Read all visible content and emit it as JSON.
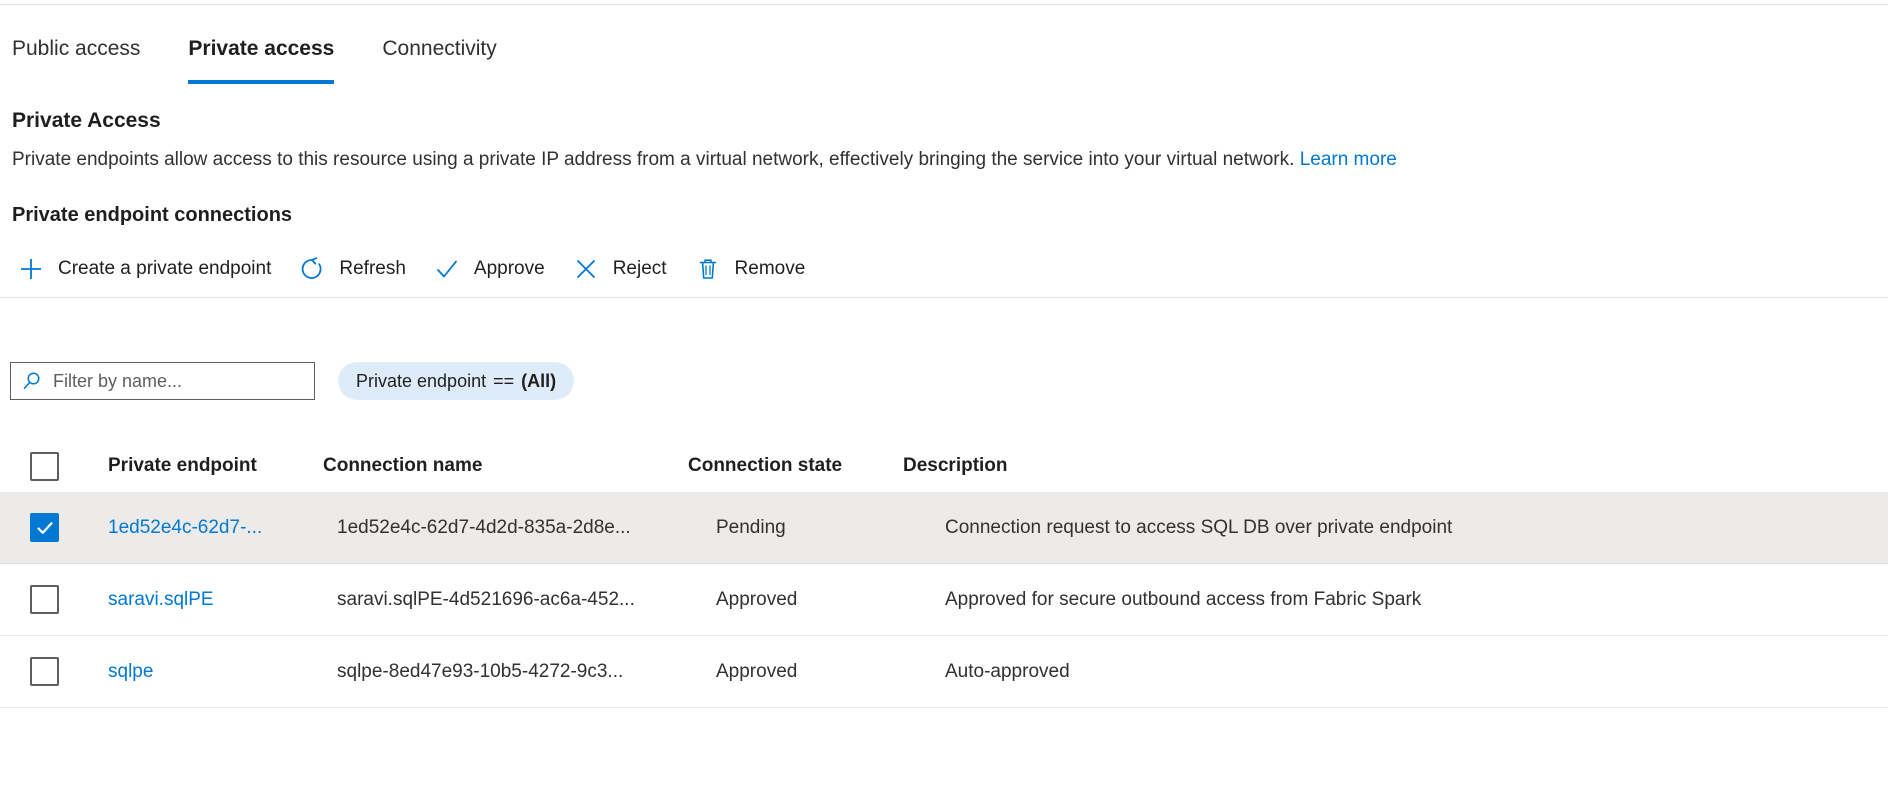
{
  "tabs": [
    {
      "label": "Public access",
      "active": false
    },
    {
      "label": "Private access",
      "active": true
    },
    {
      "label": "Connectivity",
      "active": false
    }
  ],
  "section": {
    "title": "Private Access",
    "description": "Private endpoints allow access to this resource using a private IP address from a virtual network, effectively bringing the service into your virtual network. ",
    "learn_more": "Learn more",
    "subtitle": "Private endpoint connections"
  },
  "commandbar": [
    {
      "label": "Create a private endpoint",
      "icon": "plus-icon"
    },
    {
      "label": "Refresh",
      "icon": "refresh-icon"
    },
    {
      "label": "Approve",
      "icon": "checkmark-icon"
    },
    {
      "label": "Reject",
      "icon": "cross-icon"
    },
    {
      "label": "Remove",
      "icon": "trash-icon"
    }
  ],
  "filter": {
    "search_placeholder": "Filter by name...",
    "search_value": "",
    "search_icon": "search-icon",
    "pill_label": "Private endpoint",
    "pill_operator": "==",
    "pill_value": "(All)"
  },
  "table": {
    "columns": [
      "Private endpoint",
      "Connection name",
      "Connection state",
      "Description"
    ],
    "header_checkbox_checked": false,
    "rows": [
      {
        "selected": true,
        "checked": true,
        "endpoint": "1ed52e4c-62d7-...",
        "connection_name": "1ed52e4c-62d7-4d2d-835a-2d8e...",
        "state": "Pending",
        "description": "Connection request to access SQL DB over private endpoint"
      },
      {
        "selected": false,
        "checked": false,
        "endpoint": "saravi.sqlPE",
        "connection_name": "saravi.sqlPE-4d521696-ac6a-452...",
        "state": "Approved",
        "description": "Approved for secure outbound access from Fabric Spark"
      },
      {
        "selected": false,
        "checked": false,
        "endpoint": "sqlpe",
        "connection_name": "sqlpe-8ed47e93-10b5-4272-9c3...",
        "state": "Approved",
        "description": "Auto-approved"
      }
    ]
  },
  "colors": {
    "accent": "#0078d4",
    "link": "#0078d4",
    "selected_row": "#edebe9",
    "pill_background": "#deecf9"
  }
}
